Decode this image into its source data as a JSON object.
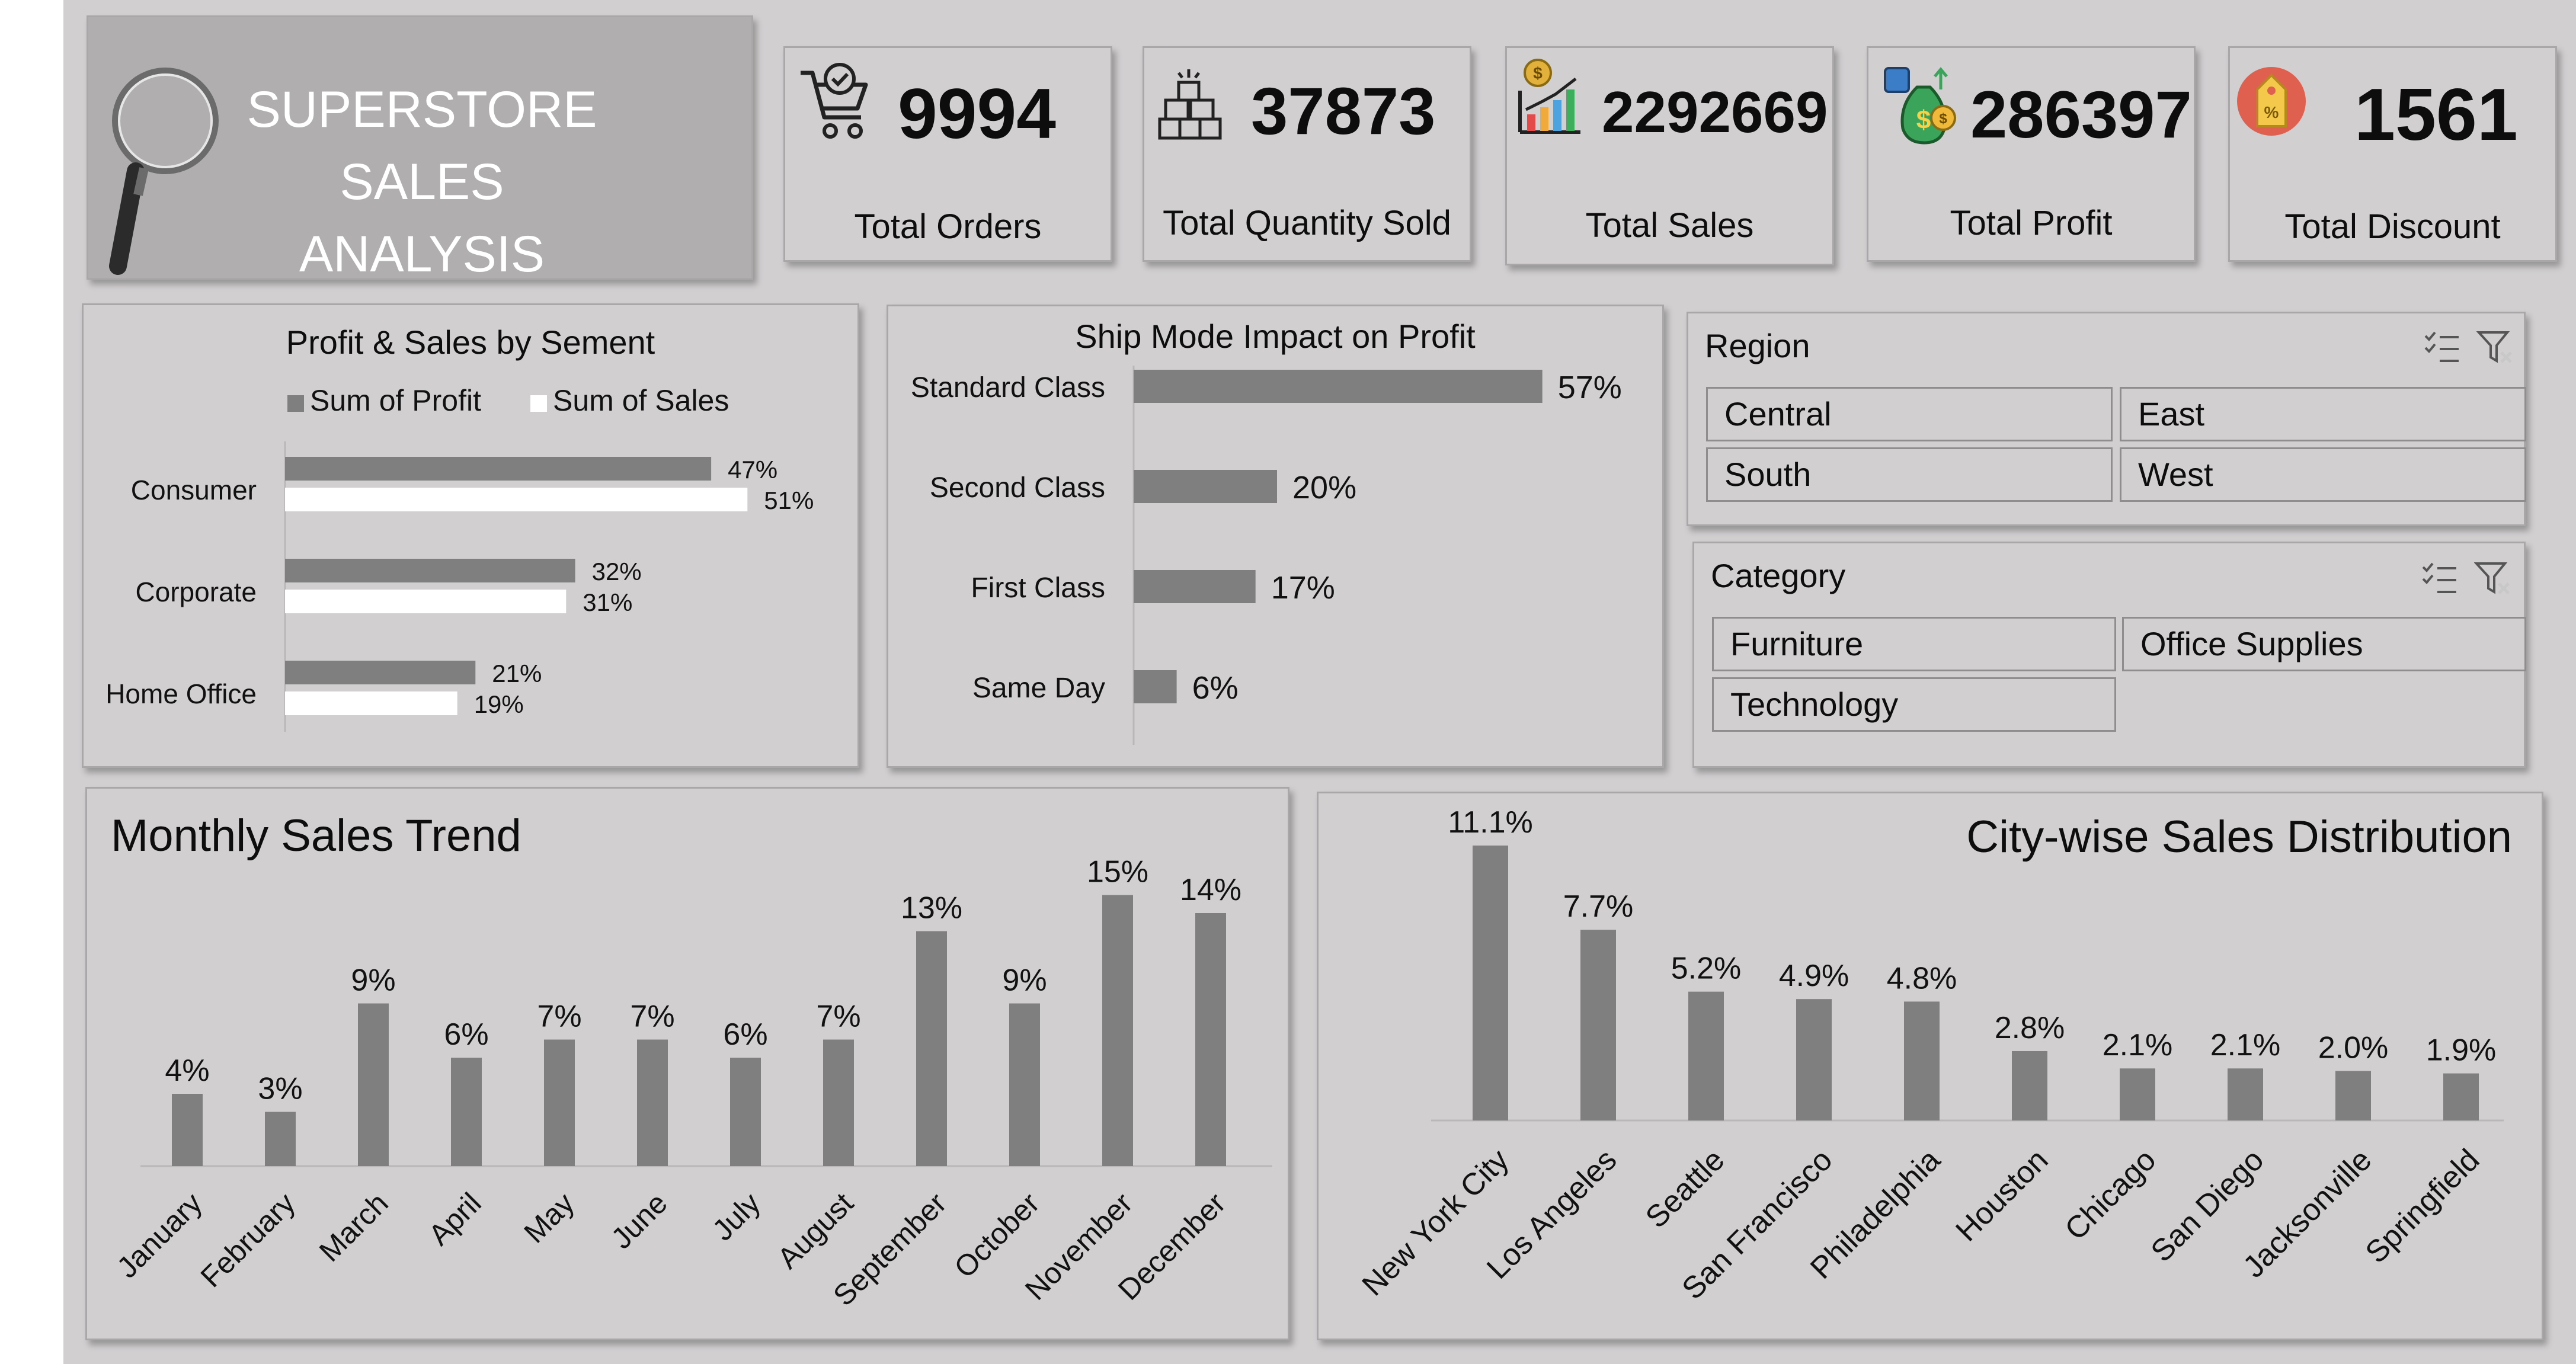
{
  "dashboard": {
    "title": "SUPERSTORE SALES ANALYSIS"
  },
  "kpis": [
    {
      "value": "9994",
      "label": "Total Orders",
      "icon": "shopping-cart-icon"
    },
    {
      "value": "37873",
      "label": "Total Quantity Sold",
      "icon": "boxes-icon"
    },
    {
      "value": "2292669",
      "label": "Total Sales",
      "icon": "bar-chart-growth-icon"
    },
    {
      "value": "286397",
      "label": "Total Profit",
      "icon": "money-bag-icon"
    },
    {
      "value": "1561",
      "label": "Total Discount",
      "icon": "price-tag-icon"
    }
  ],
  "slicers": {
    "region": {
      "title": "Region",
      "items": [
        "Central",
        "East",
        "South",
        "West"
      ]
    },
    "category": {
      "title": "Category",
      "items": [
        "Furniture",
        "Office Supplies",
        "Technology"
      ]
    }
  },
  "colors": {
    "bar": "#7f7f7f",
    "bar_light": "#ffffff",
    "panel": "#d1cfd0",
    "title_box": "#b0aeaf"
  },
  "chart_data": [
    {
      "id": "segment",
      "type": "bar",
      "orientation": "horizontal",
      "title": "Profit & Sales by Sement",
      "categories": [
        "Consumer",
        "Corporate",
        "Home Office"
      ],
      "series": [
        {
          "name": "Sum of Profit",
          "values": [
            47,
            32,
            21
          ],
          "labels": [
            "47%",
            "32%",
            "21%"
          ]
        },
        {
          "name": "Sum of Sales",
          "values": [
            51,
            31,
            19
          ],
          "labels": [
            "51%",
            "31%",
            "19%"
          ]
        }
      ],
      "legend": "top"
    },
    {
      "id": "shipmode",
      "type": "bar",
      "orientation": "horizontal",
      "title": "Ship Mode Impact on Profit",
      "categories": [
        "Standard Class",
        "Second Class",
        "First Class",
        "Same Day"
      ],
      "values": [
        57,
        20,
        17,
        6
      ],
      "labels": [
        "57%",
        "20%",
        "17%",
        "6%"
      ]
    },
    {
      "id": "monthly",
      "type": "bar",
      "title": "Monthly Sales Trend",
      "categories": [
        "January",
        "February",
        "March",
        "April",
        "May",
        "June",
        "July",
        "August",
        "September",
        "October",
        "November",
        "December"
      ],
      "values": [
        4,
        3,
        9,
        6,
        7,
        7,
        6,
        7,
        13,
        9,
        15,
        14
      ],
      "labels": [
        "4%",
        "3%",
        "9%",
        "6%",
        "7%",
        "7%",
        "6%",
        "7%",
        "13%",
        "9%",
        "15%",
        "14%"
      ]
    },
    {
      "id": "city",
      "type": "bar",
      "title": "City-wise Sales Distribution",
      "categories": [
        "New York City",
        "Los Angeles",
        "Seattle",
        "San Francisco",
        "Philadelphia",
        "Houston",
        "Chicago",
        "San Diego",
        "Jacksonville",
        "Springfield"
      ],
      "values": [
        11.1,
        7.7,
        5.2,
        4.9,
        4.8,
        2.8,
        2.1,
        2.1,
        2.0,
        1.9
      ],
      "labels": [
        "11.1%",
        "7.7%",
        "5.2%",
        "4.9%",
        "4.8%",
        "2.8%",
        "2.1%",
        "2.1%",
        "2.0%",
        "1.9%"
      ]
    }
  ]
}
